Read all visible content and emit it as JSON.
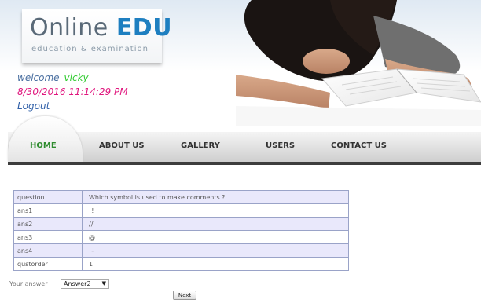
{
  "header": {
    "logo_main": "Online ",
    "logo_accent": "EDU",
    "logo_tagline": "education & examination",
    "welcome_label": "welcome",
    "username": "vicky",
    "datetime": "8/30/2016 11:14:29 PM",
    "logout_label": "Logout"
  },
  "nav": {
    "items": [
      {
        "label": "HOME",
        "active": true
      },
      {
        "label": "ABOUT US"
      },
      {
        "label": "GALLERY"
      },
      {
        "label": "USERS"
      },
      {
        "label": "CONTACT US"
      }
    ]
  },
  "question_table": {
    "rows": [
      {
        "key": "question",
        "value": "Which symbol is used to make comments ?"
      },
      {
        "key": "ans1",
        "value": "!!"
      },
      {
        "key": "ans2",
        "value": "//"
      },
      {
        "key": "ans3",
        "value": "@"
      },
      {
        "key": "ans4",
        "value": "!-"
      },
      {
        "key": "qustorder",
        "value": "1"
      }
    ]
  },
  "answer": {
    "label": "Your answer",
    "selected": "Answer2"
  },
  "next_label": "Next",
  "colors": {
    "accent": "#1e7fc0",
    "username": "#33cc33",
    "datetime": "#e0177e",
    "nav_active": "#2e8b2e",
    "row_shade": "#e9e8fb"
  }
}
